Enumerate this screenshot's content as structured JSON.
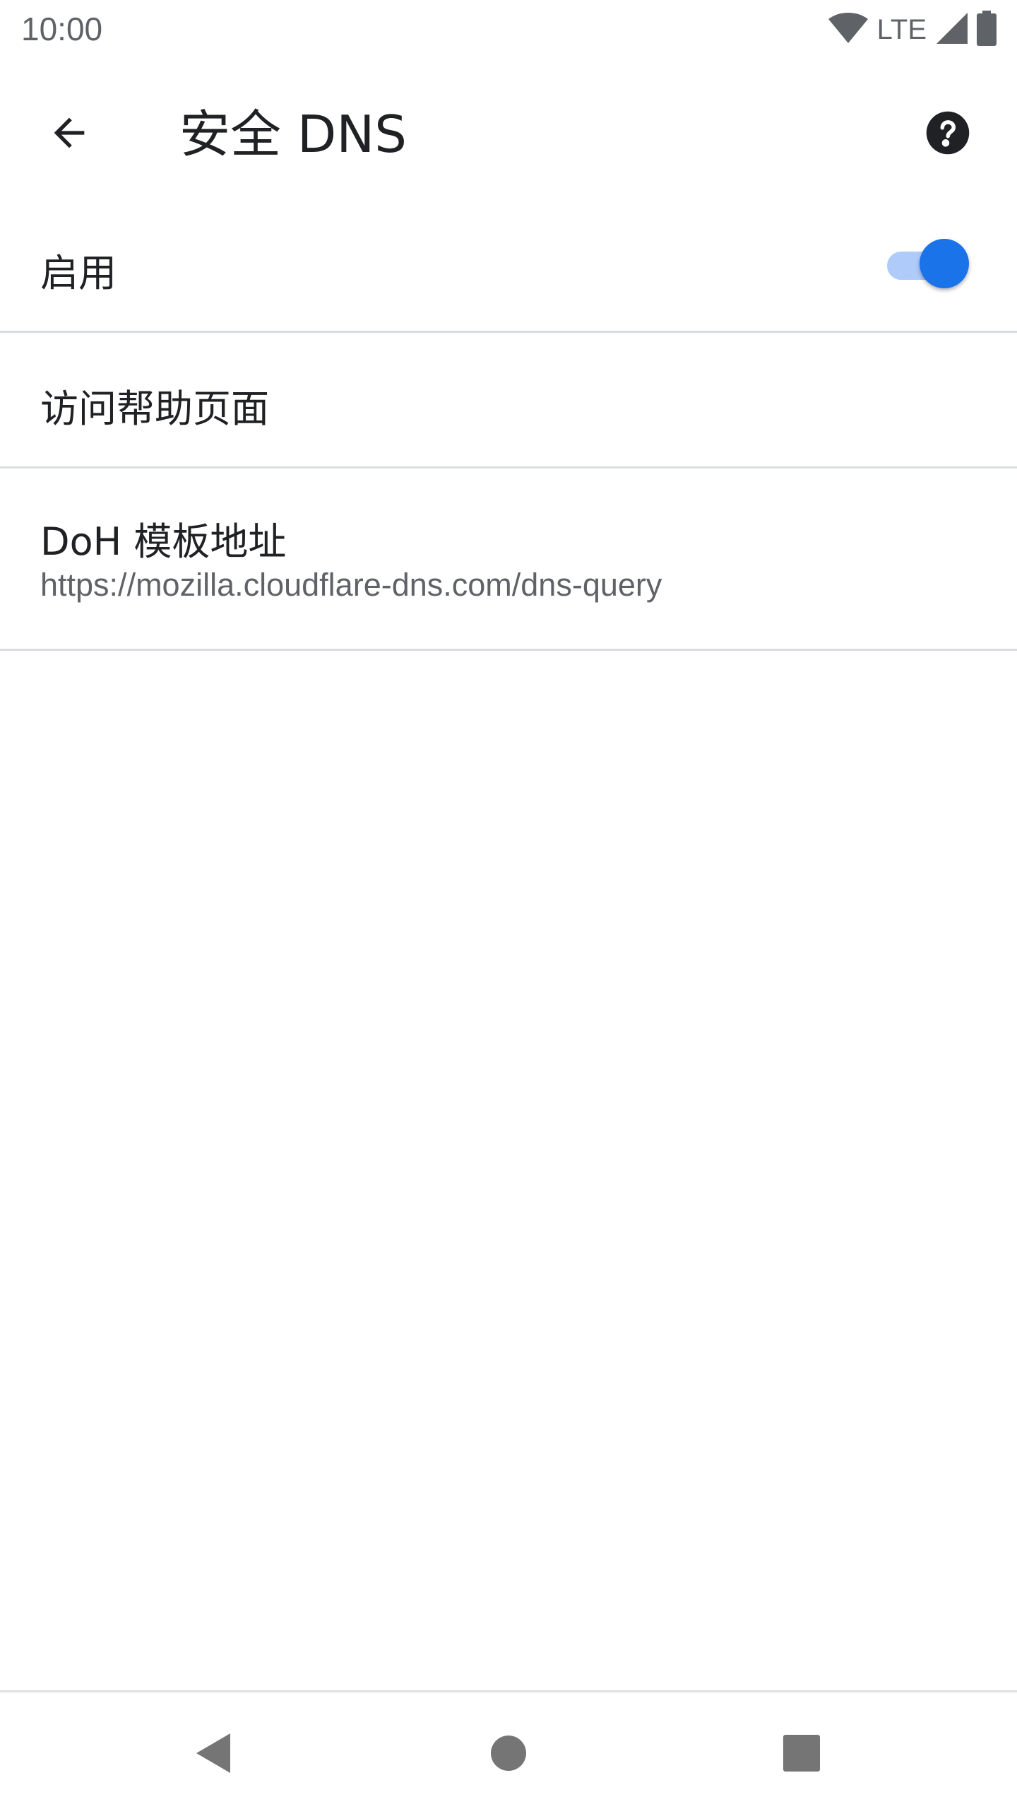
{
  "status_bar": {
    "time": "10:00",
    "network": "LTE"
  },
  "toolbar": {
    "title": "安全 DNS",
    "back_icon": "arrow-left-icon",
    "help_icon": "help-circle-icon"
  },
  "settings": {
    "enable": {
      "label": "启用",
      "toggle_on": true
    },
    "help_page": {
      "label": "访问帮助页面"
    },
    "doh_template": {
      "label": "DoH 模板地址",
      "value": "https://mozilla.cloudflare-dns.com/dns-query"
    }
  },
  "colors": {
    "accent": "#1a73e8",
    "accent_track": "#aecbfa",
    "divider": "#dadce0",
    "secondary_text": "#5f6368"
  },
  "nav_bar": {
    "back_icon": "triangle-back-icon",
    "home_icon": "circle-home-icon",
    "recents_icon": "square-recents-icon"
  }
}
